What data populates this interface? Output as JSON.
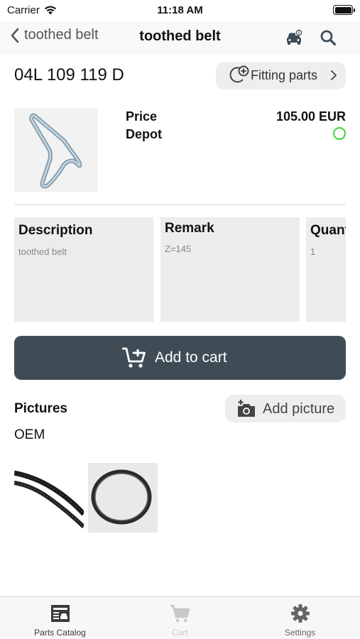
{
  "status_bar": {
    "carrier": "Carrier",
    "time": "11:18 AM"
  },
  "nav": {
    "back_label": "toothed belt",
    "title": "toothed belt",
    "icons": [
      "car-icon",
      "search-icon"
    ]
  },
  "part": {
    "number": "04L 109 119 D",
    "fitting_parts_label": "Fitting parts",
    "price_label": "Price",
    "price_value": "105.00 EUR",
    "depot_label": "Depot",
    "depot_status_color": "#3dd13d"
  },
  "cards": [
    {
      "title": "Description",
      "value": "toothed belt"
    },
    {
      "title": "Remark",
      "value": "Z=145"
    },
    {
      "title": "Quantity",
      "value": "1"
    }
  ],
  "actions": {
    "add_to_cart_label": "Add to cart",
    "button_color": "#3f4c55"
  },
  "pictures": {
    "heading": "Pictures",
    "add_picture_label": "Add picture",
    "group_label": "OEM"
  },
  "tabs": [
    {
      "label": "Parts Catalog",
      "icon": "parts-catalog-icon",
      "active": true,
      "color": "#3a3a3a"
    },
    {
      "label": "Cart",
      "icon": "cart-icon",
      "active": false,
      "color": "#c8c8c8"
    },
    {
      "label": "Settings",
      "icon": "gear-icon",
      "active": false,
      "color": "#666666"
    }
  ]
}
